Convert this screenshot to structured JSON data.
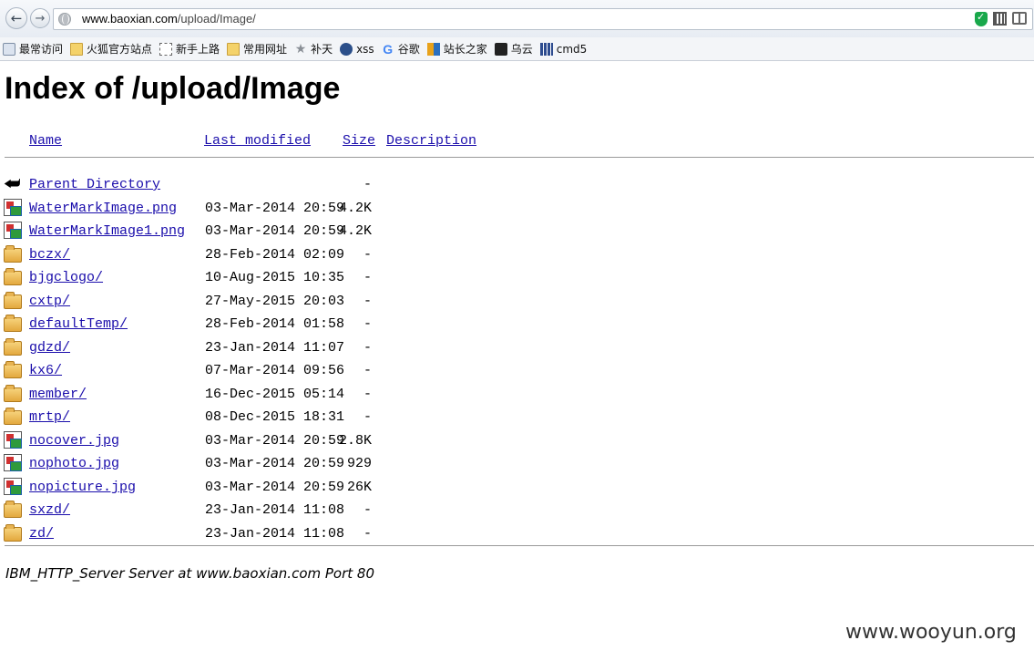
{
  "browser": {
    "url_host": "www.baoxian.com",
    "url_path": "/upload/Image/",
    "back_glyph": "←",
    "forward_glyph": "→",
    "bookmarks": [
      {
        "label": "最常访问",
        "icon": "recent-icon"
      },
      {
        "label": "火狐官方站点",
        "icon": "folder-icon"
      },
      {
        "label": "新手上路",
        "icon": "page-icon"
      },
      {
        "label": "常用网址",
        "icon": "folder-icon"
      },
      {
        "label": "补天",
        "icon": "star-icon"
      },
      {
        "label": "xss",
        "icon": "xss-icon"
      },
      {
        "label": "谷歌",
        "icon": "google-icon"
      },
      {
        "label": "站长之家",
        "icon": "admin-icon"
      },
      {
        "label": "乌云",
        "icon": "cloud-icon"
      },
      {
        "label": "cmd5",
        "icon": "cmd5-icon"
      }
    ]
  },
  "page": {
    "title": "Index of /upload/Image",
    "columns": {
      "name": "Name",
      "modified": "Last modified",
      "size": "Size",
      "description": "Description"
    },
    "rows": [
      {
        "icon": "back",
        "name": "Parent Directory",
        "modified": "",
        "size": "-"
      },
      {
        "icon": "image",
        "name": "WaterMarkImage.png",
        "modified": "03-Mar-2014 20:59",
        "size": "4.2K"
      },
      {
        "icon": "image",
        "name": "WaterMarkImage1.png",
        "modified": "03-Mar-2014 20:59",
        "size": "4.2K"
      },
      {
        "icon": "folder",
        "name": "bczx/",
        "modified": "28-Feb-2014 02:09",
        "size": "-"
      },
      {
        "icon": "folder",
        "name": "bjgclogo/",
        "modified": "10-Aug-2015 10:35",
        "size": "-"
      },
      {
        "icon": "folder",
        "name": "cxtp/",
        "modified": "27-May-2015 20:03",
        "size": "-"
      },
      {
        "icon": "folder",
        "name": "defaultTemp/",
        "modified": "28-Feb-2014 01:58",
        "size": "-"
      },
      {
        "icon": "folder",
        "name": "gdzd/",
        "modified": "23-Jan-2014 11:07",
        "size": "-"
      },
      {
        "icon": "folder",
        "name": "kx6/",
        "modified": "07-Mar-2014 09:56",
        "size": "-"
      },
      {
        "icon": "folder",
        "name": "member/",
        "modified": "16-Dec-2015 05:14",
        "size": "-"
      },
      {
        "icon": "folder",
        "name": "mrtp/",
        "modified": "08-Dec-2015 18:31",
        "size": "-"
      },
      {
        "icon": "image",
        "name": "nocover.jpg",
        "modified": "03-Mar-2014 20:59",
        "size": "2.8K"
      },
      {
        "icon": "image",
        "name": "nophoto.jpg",
        "modified": "03-Mar-2014 20:59",
        "size": "929"
      },
      {
        "icon": "image",
        "name": "nopicture.jpg",
        "modified": "03-Mar-2014 20:59",
        "size": "26K"
      },
      {
        "icon": "folder",
        "name": "sxzd/",
        "modified": "23-Jan-2014 11:08",
        "size": "-"
      },
      {
        "icon": "folder",
        "name": "zd/",
        "modified": "23-Jan-2014 11:08",
        "size": "-"
      }
    ],
    "footer": "IBM_HTTP_Server Server at www.baoxian.com Port 80"
  },
  "watermark": "www.wooyun.org"
}
